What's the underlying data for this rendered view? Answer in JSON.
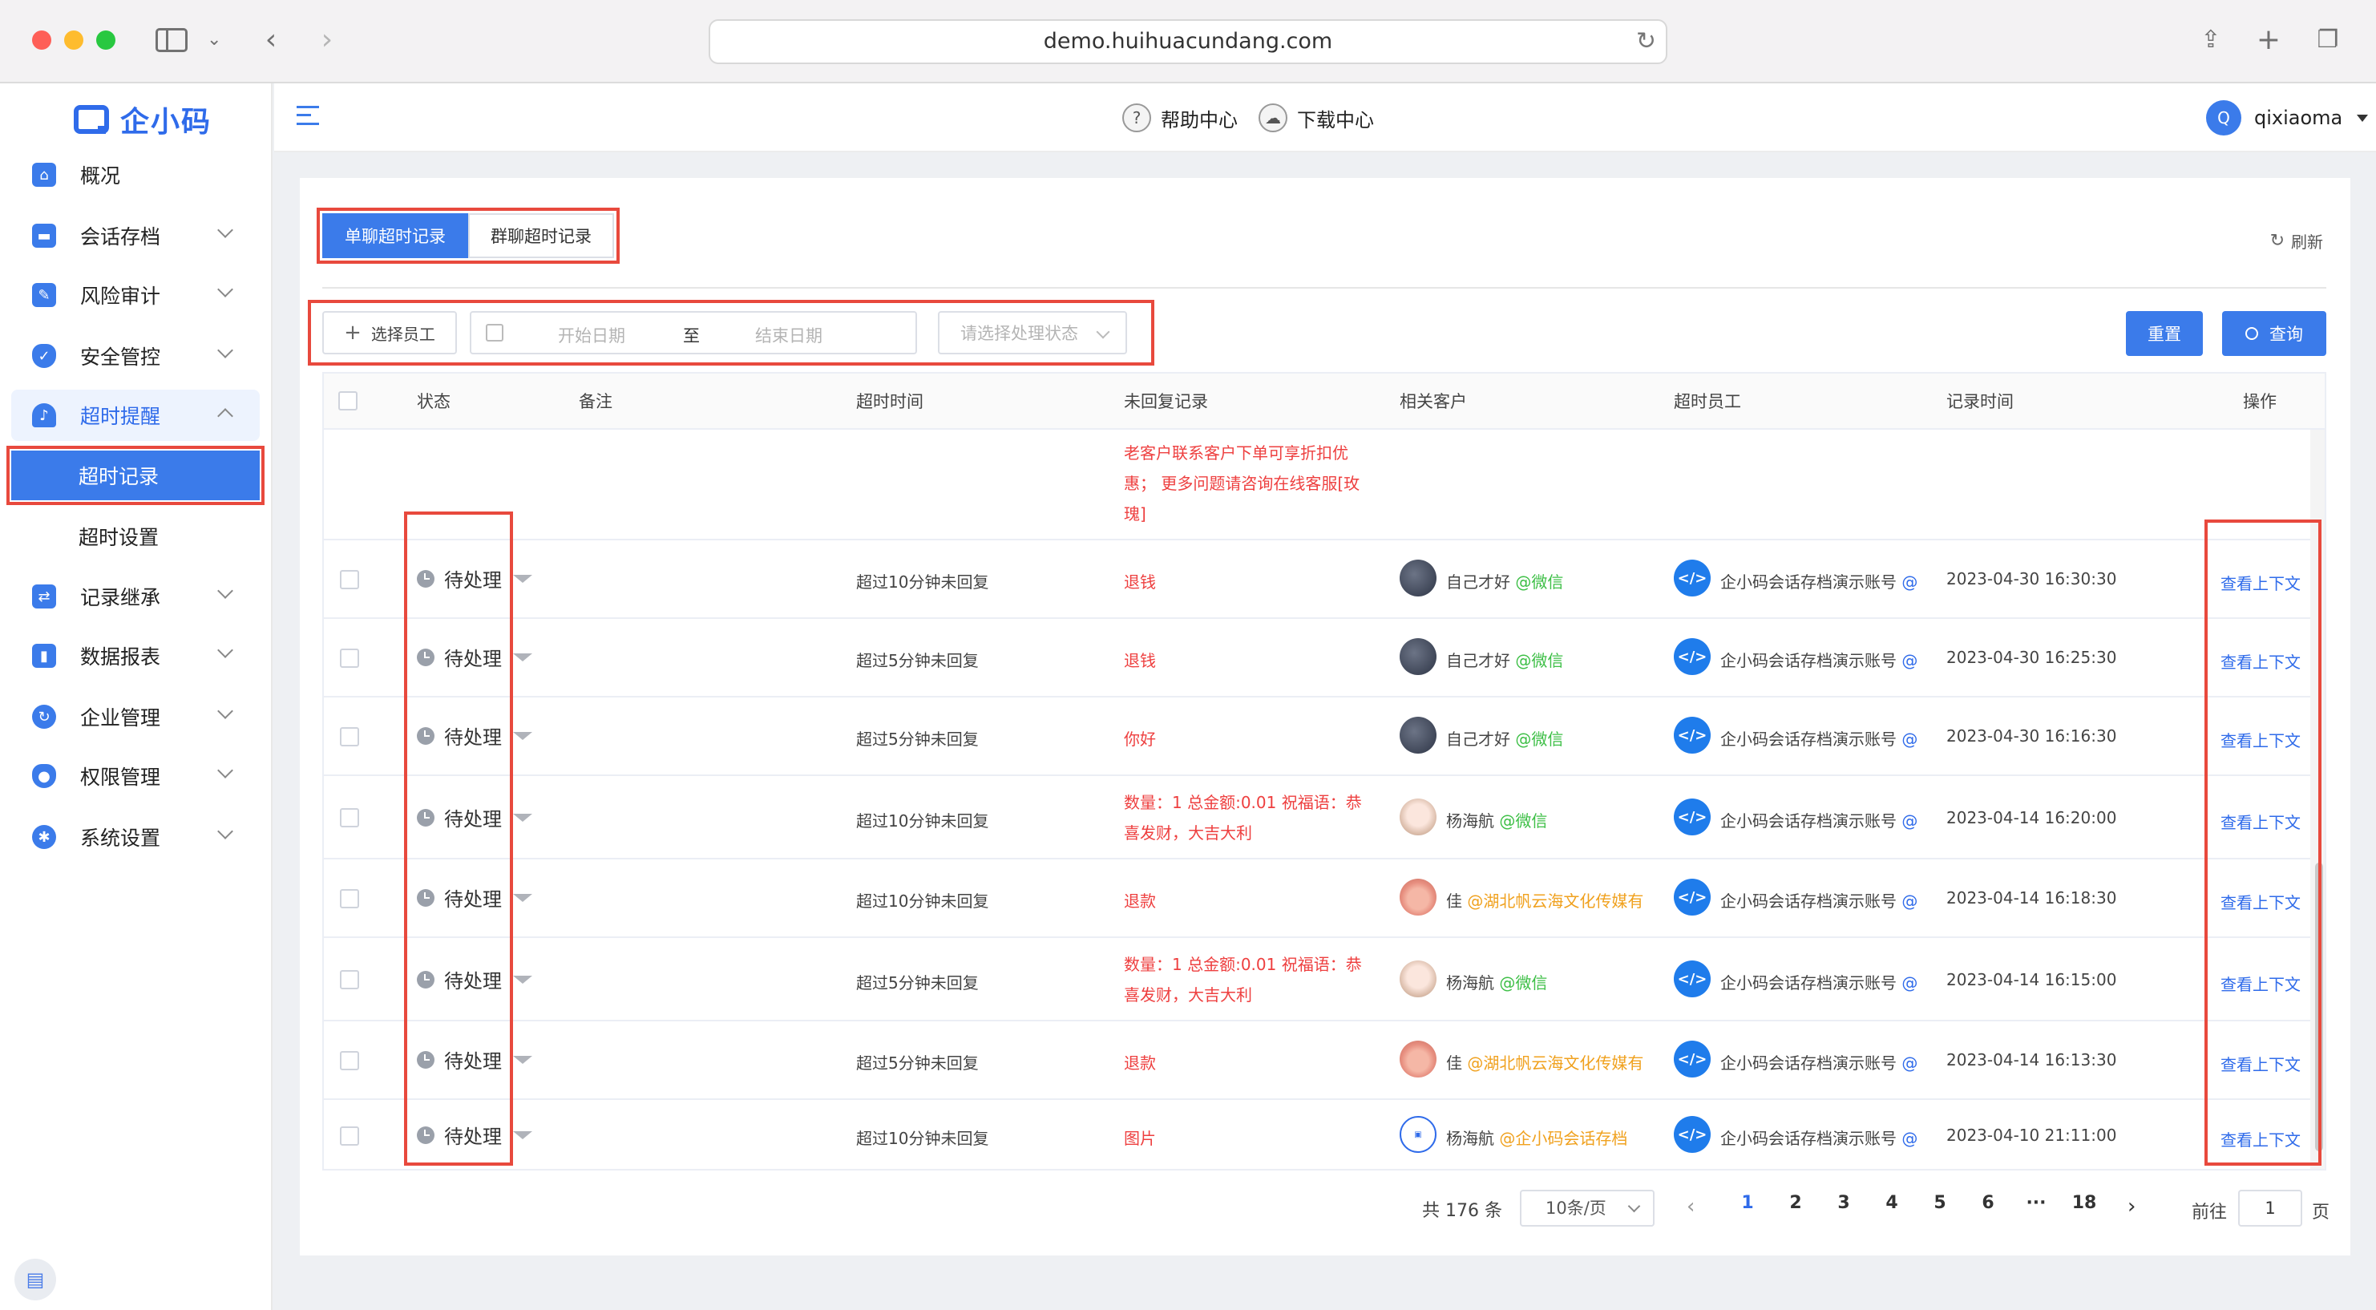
{
  "browser": {
    "url": "demo.huihuacundang.com"
  },
  "sidebar": {
    "logo": "企小码",
    "items": [
      {
        "label": "概况",
        "icon": "home-icon"
      },
      {
        "label": "会话存档",
        "icon": "folder-icon"
      },
      {
        "label": "风险审计",
        "icon": "edit-icon"
      },
      {
        "label": "安全管控",
        "icon": "shield-icon"
      },
      {
        "label": "超时提醒",
        "icon": "bell-icon"
      },
      {
        "label": "记录继承",
        "icon": "inherit-icon"
      },
      {
        "label": "数据报表",
        "icon": "chart-icon"
      },
      {
        "label": "企业管理",
        "icon": "refresh-icon"
      },
      {
        "label": "权限管理",
        "icon": "lock-shield-icon"
      },
      {
        "label": "系统设置",
        "icon": "gear-icon"
      }
    ],
    "sub_items": [
      {
        "label": "超时记录"
      },
      {
        "label": "超时设置"
      }
    ]
  },
  "header": {
    "help": "帮助中心",
    "download": "下载中心",
    "avatar_letter": "Q",
    "username": "qixiaoma"
  },
  "tabs": [
    {
      "label": "单聊超时记录"
    },
    {
      "label": "群聊超时记录"
    }
  ],
  "refresh_label": "刷新",
  "filters": {
    "employee_button": "选择员工",
    "start_date_placeholder": "开始日期",
    "to": "至",
    "end_date_placeholder": "结束日期",
    "status_placeholder": "请选择处理状态"
  },
  "buttons": {
    "reset": "重置",
    "query": "查询"
  },
  "table": {
    "columns": [
      "状态",
      "备注",
      "超时时间",
      "未回复记录",
      "相关客户",
      "超时员工",
      "记录时间",
      "操作"
    ],
    "partial_row": {
      "unreplied": [
        "老客户联系客户下单可享折扣优",
        "惠； 更多问题请咨询在线客服[玫",
        "瑰]"
      ]
    },
    "rows": [
      {
        "status": "待处理",
        "timeout": "超过10分钟未回复",
        "unreplied": [
          "退钱"
        ],
        "customer": "自己才好",
        "source": "@微信",
        "employee": "企小码会话存档演示账号",
        "employee_suffix": "@",
        "time": "2023-04-30 16:30:30",
        "action": "查看上下文"
      },
      {
        "status": "待处理",
        "timeout": "超过5分钟未回复",
        "unreplied": [
          "退钱"
        ],
        "customer": "自己才好",
        "source": "@微信",
        "employee": "企小码会话存档演示账号",
        "employee_suffix": "@",
        "time": "2023-04-30 16:25:30",
        "action": "查看上下文"
      },
      {
        "status": "待处理",
        "timeout": "超过5分钟未回复",
        "unreplied": [
          "你好"
        ],
        "customer": "自己才好",
        "source": "@微信",
        "employee": "企小码会话存档演示账号",
        "employee_suffix": "@",
        "time": "2023-04-30 16:16:30",
        "action": "查看上下文"
      },
      {
        "status": "待处理",
        "timeout": "超过10分钟未回复",
        "unreplied": [
          "数量：1 总金额:0.01 祝福语：恭",
          "喜发财，大吉大利"
        ],
        "customer": "杨海航",
        "source": "@微信",
        "employee": "企小码会话存档演示账号",
        "employee_suffix": "@",
        "time": "2023-04-14 16:20:00",
        "action": "查看上下文"
      },
      {
        "status": "待处理",
        "timeout": "超过10分钟未回复",
        "unreplied": [
          "退款"
        ],
        "customer": "佳",
        "source": "@湖北帆云海文化传媒有",
        "employee": "企小码会话存档演示账号",
        "employee_suffix": "@",
        "time": "2023-04-14 16:18:30",
        "action": "查看上下文"
      },
      {
        "status": "待处理",
        "timeout": "超过5分钟未回复",
        "unreplied": [
          "数量：1 总金额:0.01 祝福语：恭",
          "喜发财，大吉大利"
        ],
        "customer": "杨海航",
        "source": "@微信",
        "employee": "企小码会话存档演示账号",
        "employee_suffix": "@",
        "time": "2023-04-14 16:15:00",
        "action": "查看上下文"
      },
      {
        "status": "待处理",
        "timeout": "超过5分钟未回复",
        "unreplied": [
          "退款"
        ],
        "customer": "佳",
        "source": "@湖北帆云海文化传媒有",
        "employee": "企小码会话存档演示账号",
        "employee_suffix": "@",
        "time": "2023-04-14 16:13:30",
        "action": "查看上下文"
      },
      {
        "status": "待处理",
        "timeout": "超过10分钟未回复",
        "unreplied": [
          "图片"
        ],
        "customer": "杨海航",
        "source": "@企小码会话存档",
        "employee": "企小码会话存档演示账号",
        "employee_suffix": "@",
        "time": "2023-04-10 21:11:00",
        "action": "查看上下文"
      }
    ]
  },
  "pagination": {
    "total": "共 176 条",
    "page_size": "10条/页",
    "pages": [
      "1",
      "2",
      "3",
      "4",
      "5",
      "6",
      "···",
      "18"
    ],
    "current": "1",
    "goto_prefix": "前往",
    "goto_value": "1",
    "goto_suffix": "页"
  }
}
